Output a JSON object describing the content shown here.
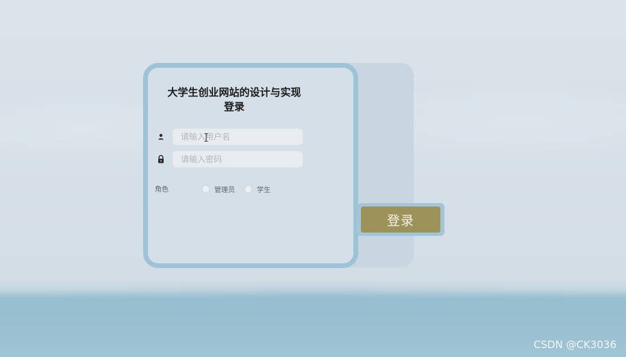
{
  "login": {
    "title": "大学生创业网站的设计与实现登录",
    "username_placeholder": "请输入用户名",
    "password_placeholder": "请输入密码",
    "role_label": "角色",
    "roles": [
      {
        "label": "管理员"
      },
      {
        "label": "学生"
      }
    ],
    "submit_label": "登录"
  },
  "icons": {
    "username": "user-icon",
    "password": "lock-icon"
  },
  "watermark": "CSDN @CK3036",
  "colors": {
    "card_border": "#9dc3d7",
    "button_bg": "#9d925a",
    "button_frame": "#a2c5d7"
  }
}
